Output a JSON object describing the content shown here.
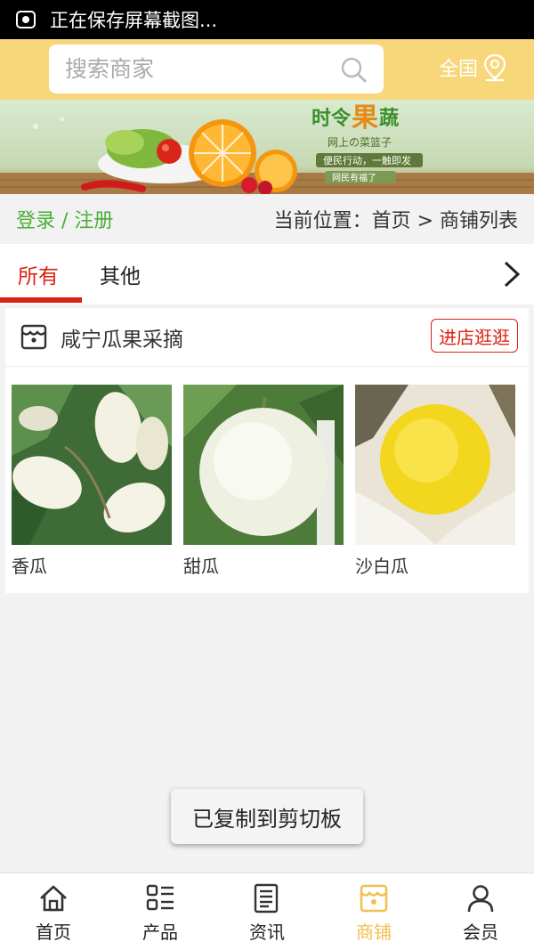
{
  "status_bar": {
    "text": "正在保存屏幕截图..."
  },
  "header": {
    "search_placeholder": "搜索商家",
    "region_label": "全国"
  },
  "banner": {
    "title_pre": "时令",
    "title_mid": "果",
    "title_post": "蔬",
    "subtitle": "网上の菜篮子",
    "slogan1": "便民行动，一触即发",
    "slogan2": "网民有福了"
  },
  "breadcrumb": {
    "login": "登录 / 注册",
    "path": "当前位置：首页 > 商铺列表"
  },
  "tabs": [
    {
      "label": "所有",
      "active": true
    },
    {
      "label": "其他",
      "active": false
    }
  ],
  "shop": {
    "name": "咸宁瓜果采摘",
    "enter_label": "进店逛逛",
    "products": [
      {
        "name": "香瓜"
      },
      {
        "name": "甜瓜"
      },
      {
        "name": "沙白瓜"
      }
    ]
  },
  "toast": "已复制到剪切板",
  "bottom_nav": [
    {
      "label": "首页",
      "icon": "home-icon"
    },
    {
      "label": "产品",
      "icon": "grid-list-icon"
    },
    {
      "label": "资讯",
      "icon": "news-icon"
    },
    {
      "label": "商铺",
      "icon": "shop-icon",
      "active": true
    },
    {
      "label": "会员",
      "icon": "user-icon"
    }
  ],
  "colors": {
    "header_bg": "#f7d77a",
    "accent_red": "#dd2211",
    "login_green": "#4caf3a",
    "nav_active": "#f0c050"
  }
}
